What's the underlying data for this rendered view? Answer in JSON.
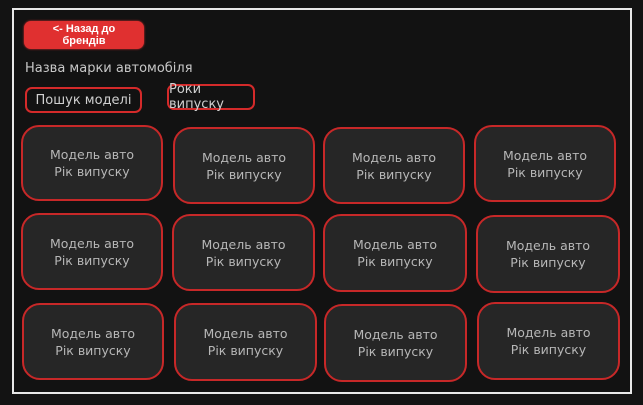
{
  "back_button": "<- Назад до брендів",
  "brand_title": "Назва марки автомобіля",
  "filters": {
    "search": "Пошук моделі",
    "years": "Роки випуску"
  },
  "cards": [
    {
      "model": "Модель авто",
      "year": "Рік випуску"
    },
    {
      "model": "Модель авто",
      "year": "Рік випуску"
    },
    {
      "model": "Модель авто",
      "year": "Рік випуску"
    },
    {
      "model": "Модель авто",
      "year": "Рік випуску"
    },
    {
      "model": "Модель авто",
      "year": "Рік випуску"
    },
    {
      "model": "Модель авто",
      "year": "Рік випуску"
    },
    {
      "model": "Модель авто",
      "year": "Рік випуску"
    },
    {
      "model": "Модель авто",
      "year": "Рік випуску"
    },
    {
      "model": "Модель авто",
      "year": "Рік випуску"
    },
    {
      "model": "Модель авто",
      "year": "Рік випуску"
    },
    {
      "model": "Модель авто",
      "year": "Рік випуску"
    },
    {
      "model": "Модель авто",
      "year": "Рік випуску"
    }
  ],
  "colors": {
    "accent": "#e03030",
    "card_border": "#c72828",
    "card_bg": "#262626",
    "background": "#121212"
  }
}
